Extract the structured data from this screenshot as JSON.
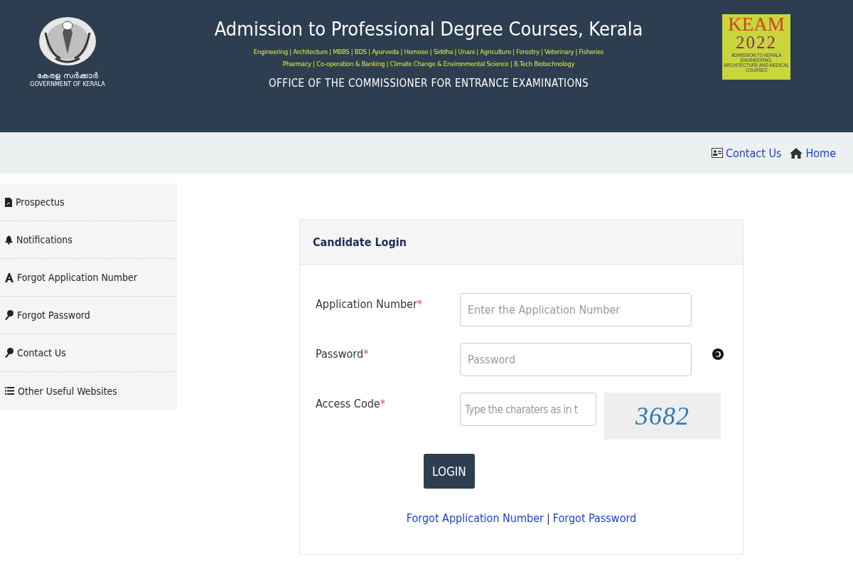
{
  "header": {
    "emblem_caption": "കേരള സർക്കാർ",
    "emblem_caption_en": "GOVERNMENT OF KERALA",
    "title": "Admission to Professional Degree Courses, Kerala",
    "course_lines": [
      "Engineering | Architecture | MBBS | BDS | Ayurveda | Homoeo | Siddha | Unani | Agriculture | Forestry | Veterinary | Fisheries",
      "Pharmacy | Co-operation & Banking | Climate Change & Environmental Science | B.Tech Biotechnology"
    ],
    "office": "OFFICE OF THE COMMISSIONER FOR ENTRANCE EXAMINATIONS",
    "badge": {
      "name": "KEAM",
      "year": "2022",
      "caption": "ADMISSION TO KERALA ENGINEERING, ARCHITECTURE AND MEDICAL COURSES"
    }
  },
  "top_links": [
    {
      "kind": "contact",
      "label": "Contact Us"
    },
    {
      "kind": "home",
      "label": "Home"
    }
  ],
  "sidebar": {
    "items": [
      {
        "kind": "pdf",
        "label": "Prospectus"
      },
      {
        "kind": "bell",
        "label": "Notifications"
      },
      {
        "kind": "letter",
        "label": "Forgot Application Number"
      },
      {
        "kind": "key",
        "label": "Forgot Password"
      },
      {
        "kind": "key",
        "label": "Contact Us"
      },
      {
        "kind": "list",
        "label": "Other Useful Websites"
      }
    ]
  },
  "login": {
    "title": "Candidate Login",
    "fields": [
      {
        "kind": "text",
        "label": "Application Number",
        "required_mark": "*",
        "placeholder": "Enter the Application Number"
      },
      {
        "kind": "password",
        "label": "Password",
        "required_mark": "*",
        "placeholder": "Password"
      },
      {
        "kind": "captcha",
        "label": "Access Code",
        "required_mark": "*",
        "placeholder": "Type the charaters as in t",
        "captcha": "3682"
      }
    ],
    "button": "LOGIN",
    "links": [
      "Forgot Application Number",
      "Forgot Password"
    ],
    "link_separator": "|"
  }
}
